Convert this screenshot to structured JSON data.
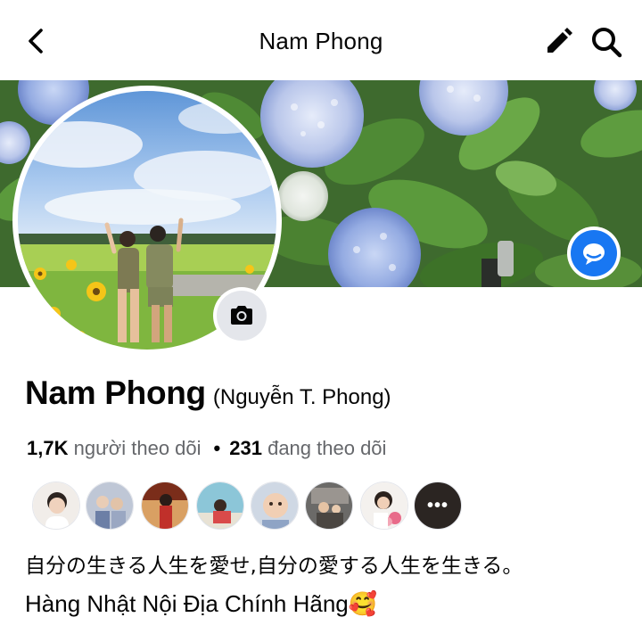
{
  "header": {
    "title": "Nam Phong",
    "back_icon": "chevron-left-icon",
    "edit_icon": "pencil-icon",
    "search_icon": "search-icon"
  },
  "cover": {
    "messenger_icon": "messenger-icon",
    "camera_icon": "camera-icon",
    "accent_color": "#1877f2"
  },
  "profile": {
    "name": "Nam Phong",
    "alternate_name": "(Nguyễn T. Phong)"
  },
  "stats": {
    "followers_count": "1,7K",
    "followers_label": "người theo dõi",
    "separator": "•",
    "following_count": "231",
    "following_label": "đang theo dõi"
  },
  "friends": {
    "more_label": "•••",
    "count_shown": 7
  },
  "bio": {
    "line1": "自分の生きる人生を愛せ,自分の愛する人生を生きる。",
    "line2": "Hàng Nhật Nội Địa Chính Hãng🥰"
  }
}
